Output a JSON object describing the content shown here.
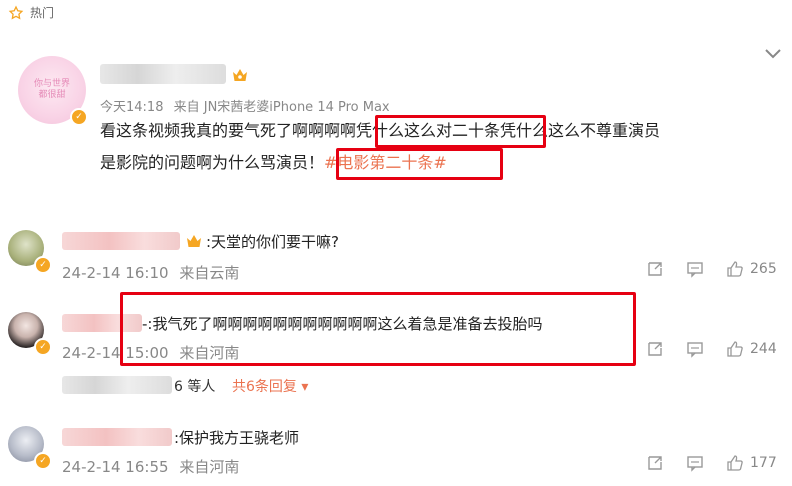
{
  "section": {
    "title": "热门"
  },
  "post": {
    "time": "今天14:18",
    "source": "来自 JN宋茜老婆iPhone 14 Pro Max",
    "text_part1": "看这条视频我真的要气死了啊啊啊啊",
    "text_highlight": "凭什么这么对二十条",
    "text_part2": "凭什么这么不尊重演员",
    "text_line2": "是影院的问题啊为什么骂演员！",
    "hashtag": "#电影第二十条#",
    "avatar_text_line1": "你与世界",
    "avatar_text_line2": "都很甜"
  },
  "comments": [
    {
      "text": ":天堂的你们要干嘛?",
      "date": "24-2-14 16:10",
      "location": "来自云南",
      "likes": "265"
    },
    {
      "text": "-:我气死了啊啊啊啊啊啊啊啊啊啊啊这么着急是准备去投胎吗",
      "date": "24-2-14 15:00",
      "location": "来自河南",
      "likes": "244",
      "replies_suffix": "6 等人",
      "replies_link": "共6条回复 ▾"
    },
    {
      "text": ":保护我方王骁老师",
      "date": "24-2-14 16:55",
      "location": "来自河南",
      "likes": "177"
    }
  ],
  "colors": {
    "accent": "#eb7350",
    "highlight_box": "#e60012"
  },
  "icons": [
    "star-icon",
    "chevron-down-icon",
    "crown-icon",
    "verified-badge-icon",
    "share-icon",
    "comment-icon",
    "like-icon"
  ]
}
